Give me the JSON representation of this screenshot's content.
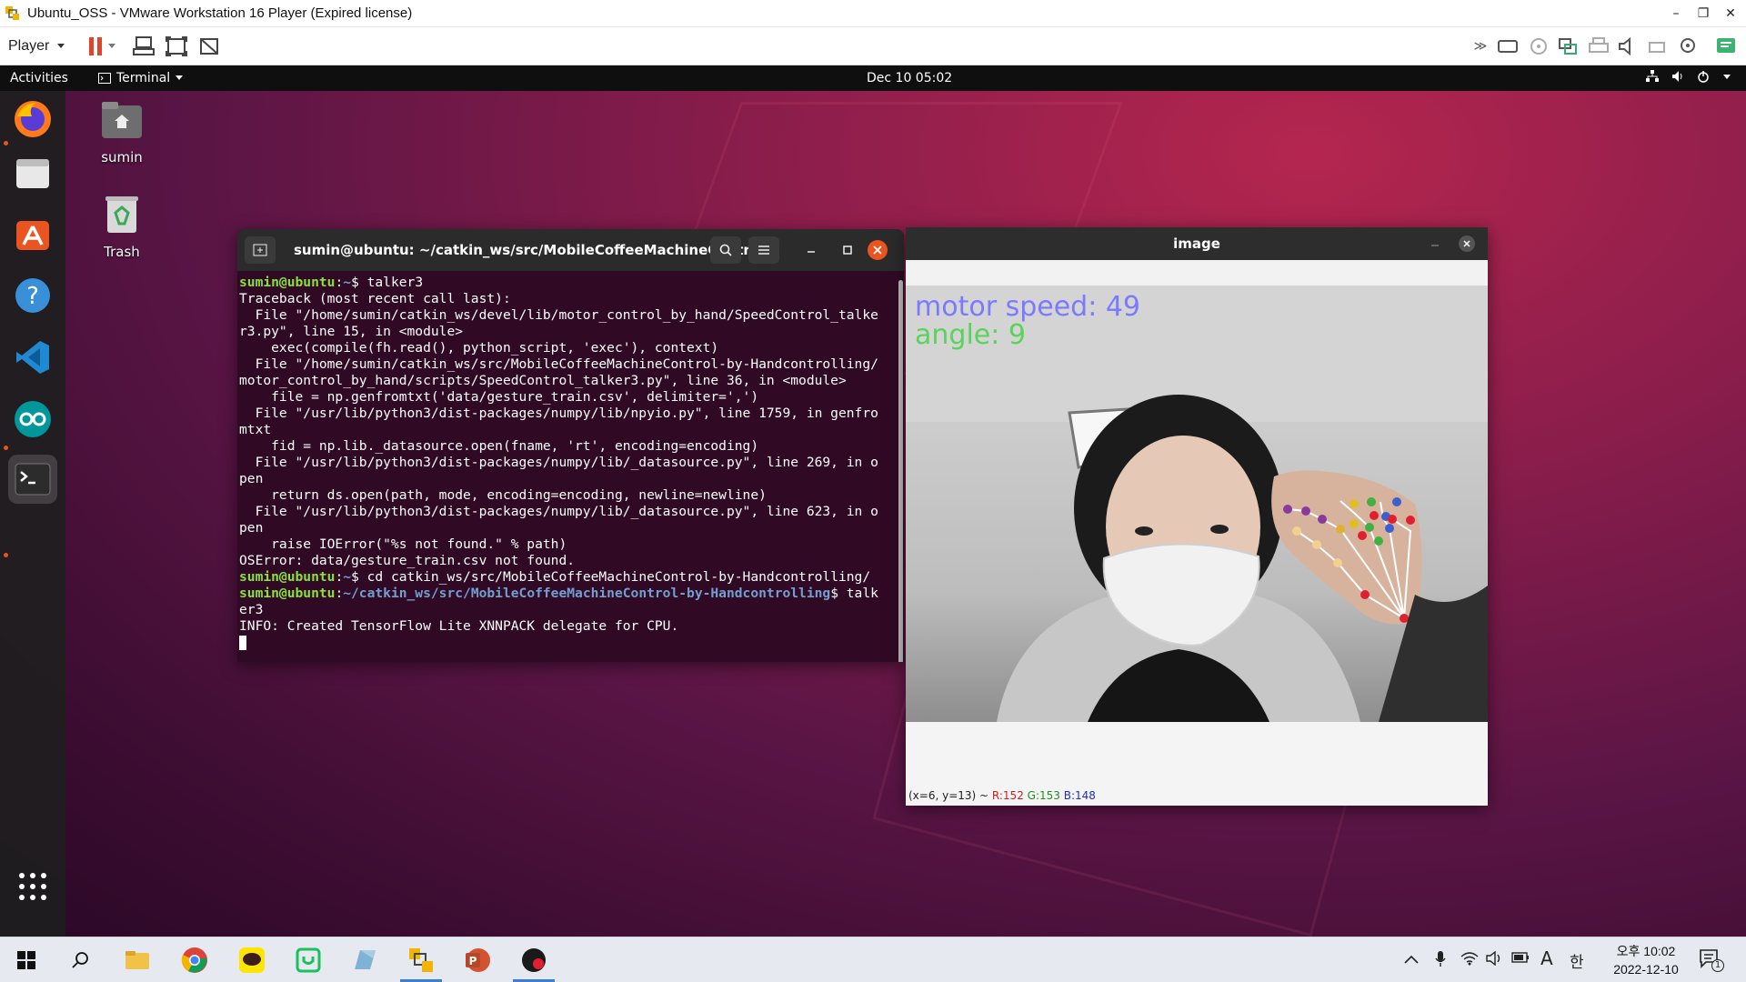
{
  "vmware": {
    "title": "Ubuntu_OSS - VMware Workstation 16 Player (Expired license)",
    "menu_player": "Player",
    "controls": {
      "minimize": "–",
      "restore": "❐",
      "close": "✕"
    }
  },
  "ubuntu": {
    "topbar": {
      "activities": "Activities",
      "app_menu": "Terminal",
      "clock": "Dec 10  05:02"
    },
    "desktop_icons": [
      {
        "label": "sumin"
      },
      {
        "label": "Trash"
      }
    ],
    "dock_items": [
      "firefox-icon",
      "files-icon",
      "software-icon",
      "help-icon",
      "vscode-icon",
      "arduino-icon",
      "terminal-icon"
    ]
  },
  "terminal": {
    "title": "sumin@ubuntu: ~/catkin_ws/src/MobileCoffeeMachineContr...",
    "lines": [
      {
        "user": "sumin@ubuntu",
        "path": "~",
        "cmd": "$ talker3"
      },
      {
        "text": "Traceback (most recent call last):"
      },
      {
        "text": "  File \"/home/sumin/catkin_ws/devel/lib/motor_control_by_hand/SpeedControl_talke"
      },
      {
        "text": "r3.py\", line 15, in <module>"
      },
      {
        "text": "    exec(compile(fh.read(), python_script, 'exec'), context)"
      },
      {
        "text": "  File \"/home/sumin/catkin_ws/src/MobileCoffeeMachineControl-by-Handcontrolling/"
      },
      {
        "text": "motor_control_by_hand/scripts/SpeedControl_talker3.py\", line 36, in <module>"
      },
      {
        "text": "    file = np.genfromtxt('data/gesture_train.csv', delimiter=',')"
      },
      {
        "text": "  File \"/usr/lib/python3/dist-packages/numpy/lib/npyio.py\", line 1759, in genfro"
      },
      {
        "text": "mtxt"
      },
      {
        "text": "    fid = np.lib._datasource.open(fname, 'rt', encoding=encoding)"
      },
      {
        "text": "  File \"/usr/lib/python3/dist-packages/numpy/lib/_datasource.py\", line 269, in o"
      },
      {
        "text": "pen"
      },
      {
        "text": "    return ds.open(path, mode, encoding=encoding, newline=newline)"
      },
      {
        "text": "  File \"/usr/lib/python3/dist-packages/numpy/lib/_datasource.py\", line 623, in o"
      },
      {
        "text": "pen"
      },
      {
        "text": "    raise IOError(\"%s not found.\" % path)"
      },
      {
        "text": "OSError: data/gesture_train.csv not found."
      },
      {
        "user": "sumin@ubuntu",
        "path": "~",
        "cmd": "$ cd catkin_ws/src/MobileCoffeeMachineControl-by-Handcontrolling/"
      },
      {
        "user": "sumin@ubuntu",
        "path": "~/catkin_ws/src/MobileCoffeeMachineControl-by-Handcontrolling",
        "cmd": "$ talk"
      },
      {
        "text": "er3"
      },
      {
        "text": "INFO: Created TensorFlow Lite XNNPACK delegate for CPU."
      }
    ]
  },
  "image_window": {
    "title": "image",
    "overlay_speed": "motor speed: 49",
    "overlay_angle": "angle: 9",
    "status_pos": "(x=6, y=13) ~ ",
    "status_r": "R:152",
    "status_g": "G:153",
    "status_b": "B:148"
  },
  "windows_taskbar": {
    "clock_time": "오후 10:02",
    "clock_date": "2022-12-10",
    "ime_lang": "A",
    "ime_korean": "한",
    "notification_count": "1"
  },
  "colors": {
    "terminal_bg": "#300a24",
    "prompt_user": "#8ae234",
    "prompt_path": "#729fcf",
    "ubuntu_accent": "#e95420",
    "overlay_speed": "#7a7aff",
    "overlay_angle": "#5ad35a"
  }
}
